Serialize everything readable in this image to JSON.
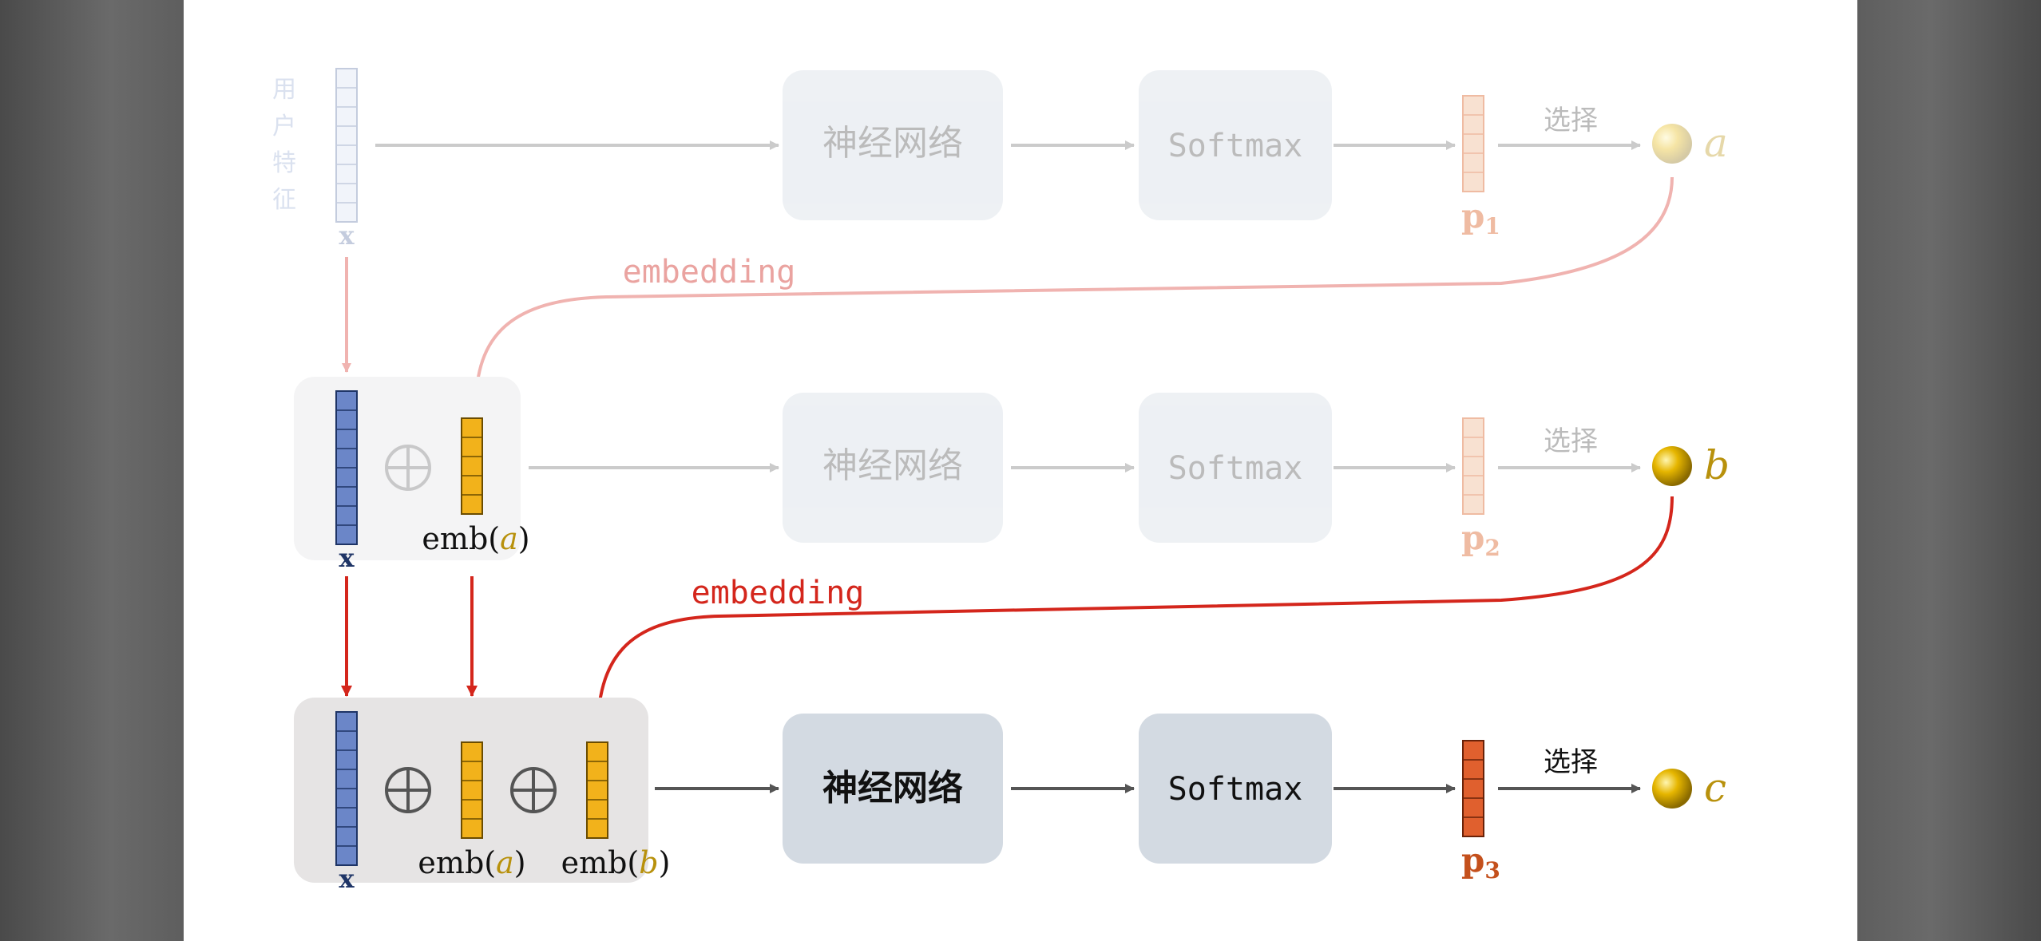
{
  "feature_label": "用户特征",
  "x_label": "x",
  "embedding_label": "embedding",
  "nn_label": "神经网络",
  "softmax_label": "Softmax",
  "select_label": "选择",
  "emb_prefix": "emb(",
  "emb_suffix": ")",
  "rows": [
    {
      "prob": "p",
      "sub": "1",
      "token": "a"
    },
    {
      "prob": "p",
      "sub": "2",
      "token": "b"
    },
    {
      "prob": "p",
      "sub": "3",
      "token": "c"
    }
  ],
  "colors": {
    "arrow_faded": "#c9c9c9",
    "arrow_dark": "#555555",
    "embed_faded": "#f0b3b0",
    "embed_dark": "#d4261c",
    "box_fill": "#dbe0e6",
    "vector_blue": "#6b86c8",
    "vector_orange": "#f2b21b",
    "prob_faded": "#f6d3bf",
    "prob_dark": "#e0602e",
    "token_gold": "#b8910c"
  }
}
